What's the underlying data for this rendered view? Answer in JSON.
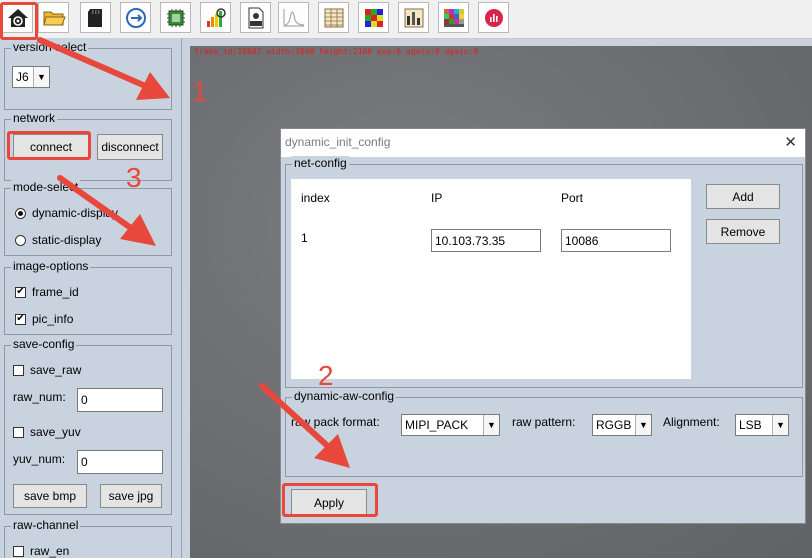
{
  "toolbar": {
    "icons": [
      "home-icon",
      "open-folder-icon",
      "sd-card-icon",
      "network-loop-icon",
      "chip-icon",
      "histogram-icon",
      "raw-file-icon",
      "waveform-icon",
      "grid-table-icon",
      "color-checker-icon",
      "bars-icon",
      "color-chart-icon",
      "gauge-icon"
    ]
  },
  "left_panel": {
    "version": {
      "title": "version select",
      "value": "J6"
    },
    "network": {
      "title": "network",
      "connect": "connect",
      "disconnect": "disconnect"
    },
    "mode": {
      "title": "mode-select",
      "options": [
        "dynamic-display",
        "static-display"
      ],
      "selected": 0
    },
    "image_options": {
      "title": "image-options",
      "frame_id": "frame_id",
      "pic_info": "pic_info"
    },
    "save_config": {
      "title": "save-config",
      "save_raw": "save_raw",
      "raw_num_label": "raw_num:",
      "raw_num": "0",
      "save_yuv": "save_yuv",
      "yuv_num_label": "yuv_num:",
      "yuv_num": "0",
      "save_bmp": "save bmp",
      "save_jpg": "save jpg"
    },
    "raw_channel": {
      "title": "raw-channel",
      "raw_en": "raw_en"
    }
  },
  "canvas": {
    "overlay": "frame_id:18687 width:3840 height:2160 exp:0 again:0 dgain:0"
  },
  "dialog": {
    "title": "dynamic_init_config",
    "net_config": {
      "title": "net-config",
      "columns": [
        "index",
        "IP",
        "Port"
      ],
      "rows": [
        {
          "index": "1",
          "ip": "10.103.73.35",
          "port": "10086"
        }
      ],
      "add": "Add",
      "remove": "Remove"
    },
    "aw_config": {
      "title": "dynamic-aw-config",
      "raw_pack_label": "raw pack format:",
      "raw_pack": "MIPI_PACK",
      "raw_pattern_label": "raw pattern:",
      "raw_pattern": "RGGB",
      "alignment_label": "Alignment:",
      "alignment": "LSB"
    },
    "apply": "Apply"
  },
  "annotations": {
    "numbers": [
      "1",
      "2",
      "3"
    ],
    "color": "#e8473b"
  }
}
